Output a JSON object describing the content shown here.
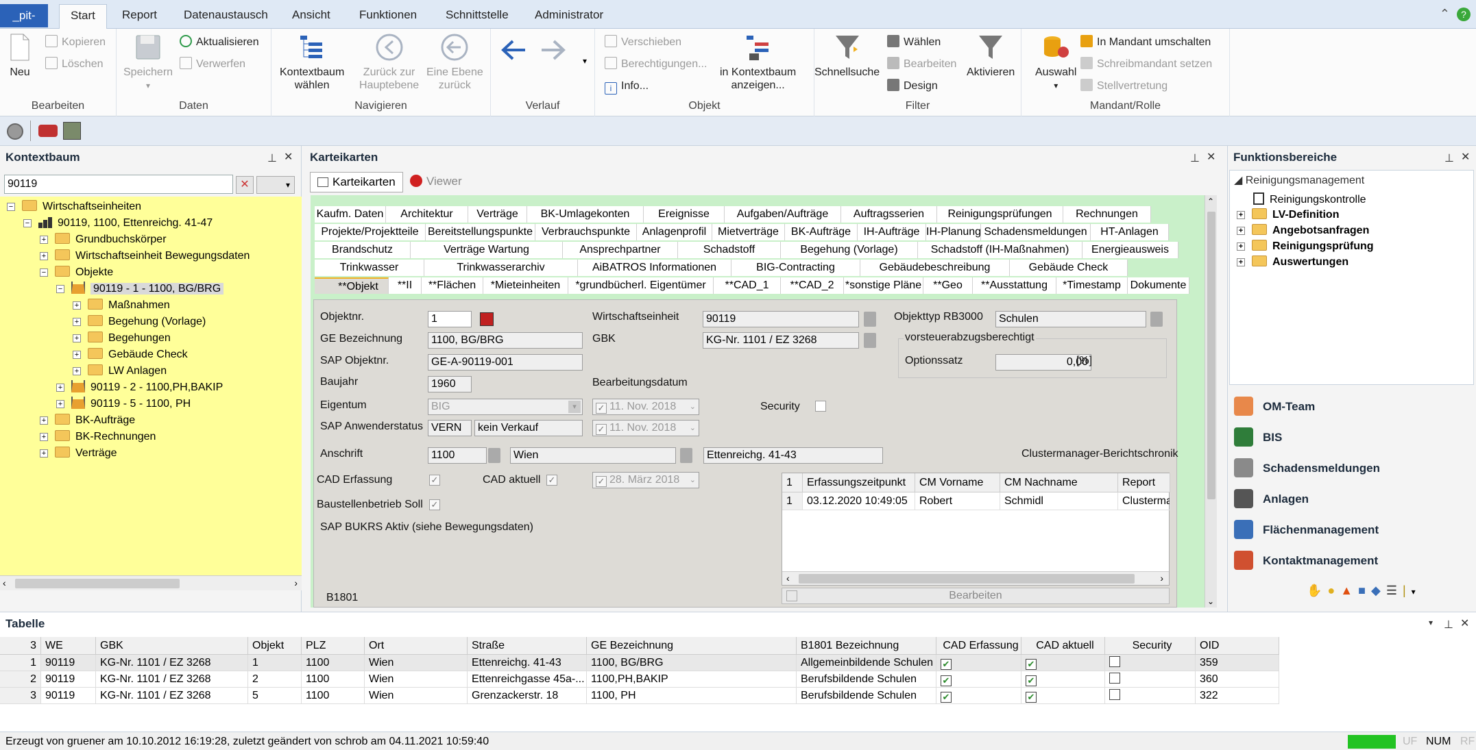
{
  "ribbon_tabs": [
    "_pit-",
    "Start",
    "Report",
    "Datenaustausch",
    "Ansicht",
    "Funktionen",
    "Schnittstelle",
    "Administrator"
  ],
  "ribbon": {
    "groups": {
      "bearbeiten": "Bearbeiten",
      "daten": "Daten",
      "navigieren": "Navigieren",
      "verlauf": "Verlauf",
      "objekt": "Objekt",
      "filter": "Filter",
      "mandant": "Mandant/Rolle"
    },
    "neu": "Neu",
    "kopieren": "Kopieren",
    "loeschen": "Löschen",
    "speichern": "Speichern",
    "aktualisieren": "Aktualisieren",
    "verwerfen": "Verwerfen",
    "kontextbaum_waehlen_1": "Kontextbaum",
    "kontextbaum_waehlen_2": "wählen",
    "zurueck_haupt_1": "Zurück zur",
    "zurueck_haupt_2": "Hauptebene",
    "eine_ebene_1": "Eine Ebene",
    "eine_ebene_2": "zurück",
    "verschieben": "Verschieben",
    "berechtigungen": "Berechtigungen...",
    "info": "Info...",
    "in_kontext_1": "in Kontextbaum",
    "in_kontext_2": "anzeigen...",
    "schnellsuche": "Schnellsuche",
    "waehlen": "Wählen",
    "f_bearbeiten": "Bearbeiten",
    "design": "Design",
    "aktivieren": "Aktivieren",
    "auswahl": "Auswahl",
    "in_mandant": "In Mandant umschalten",
    "schreibmandant": "Schreibmandant setzen",
    "stellvertretung": "Stellvertretung"
  },
  "kontextbaum": {
    "title": "Kontextbaum",
    "search_value": "90119",
    "nodes": [
      {
        "label": "Wirtschaftseinheiten",
        "level": 0,
        "exp": "−",
        "icon": "folder"
      },
      {
        "label": "90119, 1100, Ettenreichg. 41-47",
        "level": 1,
        "exp": "−",
        "icon": "building"
      },
      {
        "label": "Grundbuchskörper",
        "level": 2,
        "exp": "+",
        "icon": "folder"
      },
      {
        "label": "Wirtschaftseinheit Bewegungsdaten",
        "level": 2,
        "exp": "+",
        "icon": "folder"
      },
      {
        "label": "Objekte",
        "level": 2,
        "exp": "−",
        "icon": "folder"
      },
      {
        "label": "90119 - 1 - 1100, BG/BRG",
        "level": 3,
        "exp": "−",
        "icon": "house",
        "selected": true
      },
      {
        "label": "Maßnahmen",
        "level": 4,
        "exp": "+",
        "icon": "folder"
      },
      {
        "label": "Begehung (Vorlage)",
        "level": 4,
        "exp": "+",
        "icon": "folder"
      },
      {
        "label": "Begehungen",
        "level": 4,
        "exp": "+",
        "icon": "folder"
      },
      {
        "label": "Gebäude Check",
        "level": 4,
        "exp": "+",
        "icon": "folder"
      },
      {
        "label": "LW Anlagen",
        "level": 4,
        "exp": "+",
        "icon": "folder"
      },
      {
        "label": "90119 - 2 - 1100,PH,BAKIP",
        "level": 3,
        "exp": "+",
        "icon": "house"
      },
      {
        "label": "90119 - 5 - 1100, PH",
        "level": 3,
        "exp": "+",
        "icon": "house"
      },
      {
        "label": "BK-Aufträge",
        "level": 2,
        "exp": "+",
        "icon": "folder"
      },
      {
        "label": "BK-Rechnungen",
        "level": 2,
        "exp": "+",
        "icon": "folder"
      },
      {
        "label": "Verträge",
        "level": 2,
        "exp": "+",
        "icon": "folder"
      }
    ]
  },
  "karteikarten": {
    "title": "Karteikarten",
    "subtab_karteikarten": "Karteikarten",
    "subtab_viewer": "Viewer",
    "tab_rows": [
      [
        "Kaufm. Daten",
        "Architektur",
        "Verträge",
        "BK-Umlagekonten",
        "Ereignisse",
        "Aufgaben/Aufträge",
        "Auftragsserien",
        "Reinigungsprüfungen",
        "Rechnungen"
      ],
      [
        "Projekte/Projektteile",
        "Bereitstellungspunkte",
        "Verbrauchspunkte",
        "Anlagenprofil",
        "Mietverträge",
        "BK-Aufträge",
        "IH-Aufträge",
        "IH-Planung",
        "Schadensmeldungen",
        "HT-Anlagen"
      ],
      [
        "Brandschutz",
        "Verträge Wartung",
        "Ansprechpartner",
        "Schadstoff",
        "Begehung (Vorlage)",
        "Schadstoff (IH-Maßnahmen)",
        "Energieausweis"
      ],
      [
        "Trinkwasser",
        "Trinkwasserarchiv",
        "AiBATROS Informationen",
        "BIG-Contracting",
        "Gebäudebeschreibung",
        "Gebäude Check"
      ],
      [
        "**Objekt",
        "**II",
        "**Flächen",
        "*Mieteinheiten",
        "*grundbücherl. Eigentümer",
        "**CAD_1",
        "**CAD_2",
        "*sonstige Pläne",
        "**Geo",
        "**Ausstattung",
        "*Timestamp",
        "Dokumente"
      ]
    ],
    "form": {
      "objektnr_label": "Objektnr.",
      "objektnr": "1",
      "ge_bez_label": "GE Bezeichnung",
      "ge_bez": "1100, BG/BRG",
      "sap_objektnr_label": "SAP Objektnr.",
      "sap_objektnr": "GE-A-90119-001",
      "baujahr_label": "Baujahr",
      "baujahr": "1960",
      "eigentum_label": "Eigentum",
      "eigentum": "BIG",
      "sap_anw_label": "SAP Anwenderstatus",
      "sap_anw_code": "VERN",
      "sap_anw_text": "kein Verkauf",
      "anschrift_label": "Anschrift",
      "plz": "1100",
      "ort": "Wien",
      "strasse": "Ettenreichg. 41-43",
      "cad_erfassung_label": "CAD Erfassung",
      "cad_aktuell_label": "CAD aktuell",
      "cad_date": "28. März 2018",
      "baustellen_label": "Baustellenbetrieb Soll",
      "sap_bukrs_label": "SAP BUKRS Aktiv (siehe Bewegungsdaten)",
      "b1801_label": "B1801",
      "we_label": "Wirtschaftseinheit",
      "we": "90119",
      "gbk_label": "GBK",
      "gbk": "KG-Nr. 1101 / EZ 3268",
      "bearb_label": "Bearbeitungsdatum",
      "bearb_date1": "11. Nov. 2018",
      "bearb_date2": "11. Nov. 2018",
      "security_label": "Security",
      "objekttyp_label": "Objekttyp RB3000",
      "objekttyp": "Schulen",
      "vorsteuer_label": "vorsteuerabzugsberechtigt",
      "optionssatz_label": "Optionssatz",
      "optionssatz": "0,00",
      "percent": "[%]",
      "cluster_label": "Clustermanager-Berichtschronik",
      "cluster_count": "1",
      "cluster_headers": [
        "Erfassungszeitpunkt",
        "CM Vorname",
        "CM Nachname",
        "Report"
      ],
      "cluster_row": [
        "1",
        "03.12.2020 10:49:05",
        "Robert",
        "Schmidl",
        "Clusterman"
      ],
      "bearbeiten_btn": "Bearbeiten"
    }
  },
  "funktionsbereiche": {
    "title": "Funktionsbereiche",
    "root": "Reinigungsmanagement",
    "items": [
      "Reinigungskontrolle",
      "LV-Definition",
      "Angebotsanfragen",
      "Reinigungsprüfung",
      "Auswertungen"
    ],
    "nav": [
      "OM-Team",
      "BIS",
      "Schadensmeldungen",
      "Anlagen",
      "Flächenmanagement",
      "Kontaktmanagement"
    ],
    "nav_colors": [
      "#e8884a",
      "#2f7d3a",
      "#8a8a8a",
      "#555555",
      "#3a6fb8",
      "#d05030"
    ]
  },
  "tabelle": {
    "title": "Tabelle",
    "count": "3",
    "headers": [
      "WE",
      "GBK",
      "Objekt",
      "PLZ",
      "Ort",
      "Straße",
      "GE Bezeichnung",
      "B1801 Bezeichnung",
      "CAD Erfassung",
      "CAD aktuell",
      "Security",
      "OID"
    ],
    "rows": [
      [
        "1",
        "90119",
        "KG-Nr. 1101 / EZ 3268",
        "1",
        "1100",
        "Wien",
        "Ettenreichg. 41-43",
        "1100, BG/BRG",
        "Allgemeinbildende Schulen",
        "✔",
        "✔",
        "",
        "359"
      ],
      [
        "2",
        "90119",
        "KG-Nr. 1101 / EZ 3268",
        "2",
        "1100",
        "Wien",
        "Ettenreichgasse 45a-...",
        "1100,PH,BAKIP",
        "Berufsbildende Schulen",
        "✔",
        "✔",
        "",
        "360"
      ],
      [
        "3",
        "90119",
        "KG-Nr. 1101 / EZ 3268",
        "5",
        "1100",
        "Wien",
        "Grenzackerstr. 18",
        "1100, PH",
        "Berufsbildende Schulen",
        "✔",
        "✔",
        "",
        "322"
      ]
    ]
  },
  "status": {
    "text": "Erzeugt von gruener am 10.10.2012 16:19:28, zuletzt geändert von schrob am 04.11.2021 10:59:40",
    "uf": "UF",
    "num": "NUM",
    "rf": "RF"
  }
}
